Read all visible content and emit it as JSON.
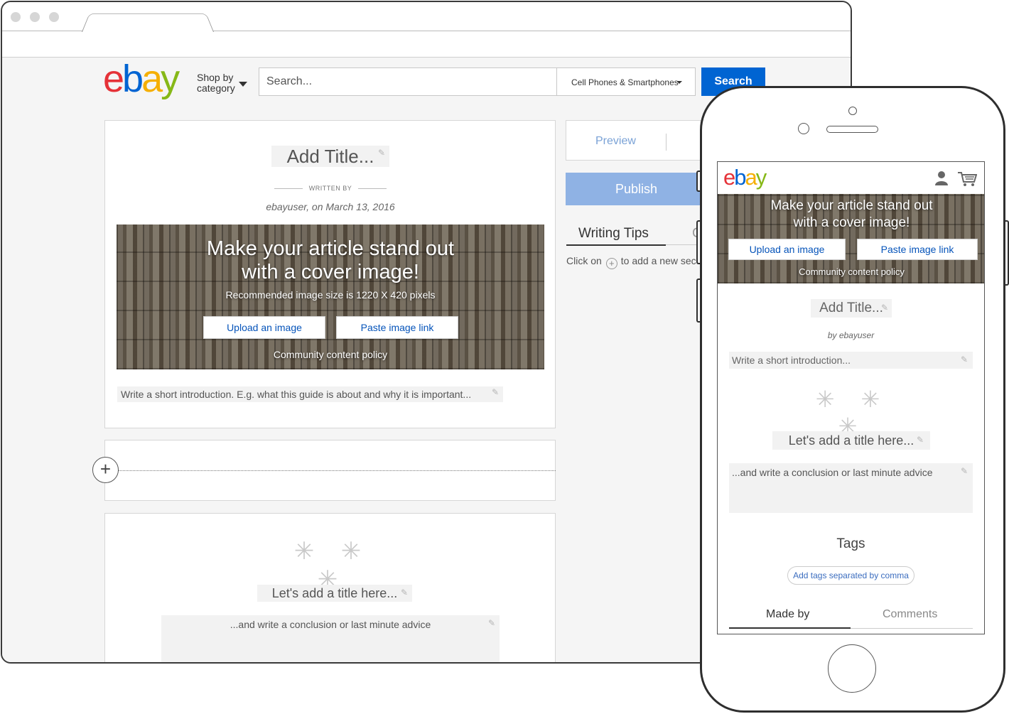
{
  "header": {
    "logo_e": "e",
    "logo_b": "b",
    "logo_a": "a",
    "logo_y": "y",
    "shop_by_line1": "Shop by",
    "shop_by_line2": "category",
    "search_placeholder": "Search...",
    "category_select": "Cell Phones & Smartphones",
    "search_button": "Search"
  },
  "editor": {
    "title_placeholder": "Add Title...",
    "written_by": "WRITTEN BY",
    "byline": "ebayuser, on March 13, 2016",
    "cover": {
      "heading_line1": "Make your article stand out",
      "heading_line2": "with a cover image!",
      "recommended": "Recommended image size is 1220 X 420 pixels",
      "upload_button": "Upload an image",
      "paste_button": "Paste image link",
      "policy_link": "Community content policy"
    },
    "intro_placeholder": "Write a short introduction. E.g. what this guide is about and why it is important...",
    "add_section_symbol": "+",
    "asterisks": "✳ ✳ ✳",
    "section_title_placeholder": "Let's add a title here...",
    "conclusion_placeholder": "...and write a conclusion or last minute advice"
  },
  "sidebar": {
    "preview_label": "Preview",
    "publish_button": "Publish",
    "tabs": [
      "Writing Tips",
      "C"
    ],
    "click_on_text": "Click on",
    "click_on_suffix": "to add a new sec"
  },
  "mobile": {
    "cover": {
      "heading_line1": "Make your article stand out",
      "heading_line2": "with a cover image!",
      "upload_button": "Upload an image",
      "paste_button": "Paste image link",
      "policy_link": "Community content policy"
    },
    "title_placeholder": "Add Title...",
    "byline": "by ebayuser",
    "intro_placeholder": "Write a short introduction...",
    "asterisks": "✳ ✳ ✳",
    "section_title_placeholder": "Let's add a title here...",
    "conclusion_placeholder": "...and write a conclusion or last minute advice",
    "tags_heading": "Tags",
    "tags_placeholder": "Add tags separated by comma",
    "tabs": [
      "Made by",
      "Comments"
    ]
  },
  "icons": {
    "pencil": "✎",
    "user": "user-icon",
    "cart": "cart-icon"
  },
  "colors": {
    "ebay_red": "#e53238",
    "ebay_blue": "#0064d2",
    "ebay_yellow": "#f5af02",
    "ebay_green": "#86b817",
    "publish_disabled": "#8fb2e4",
    "link_blue": "#0654ba"
  }
}
